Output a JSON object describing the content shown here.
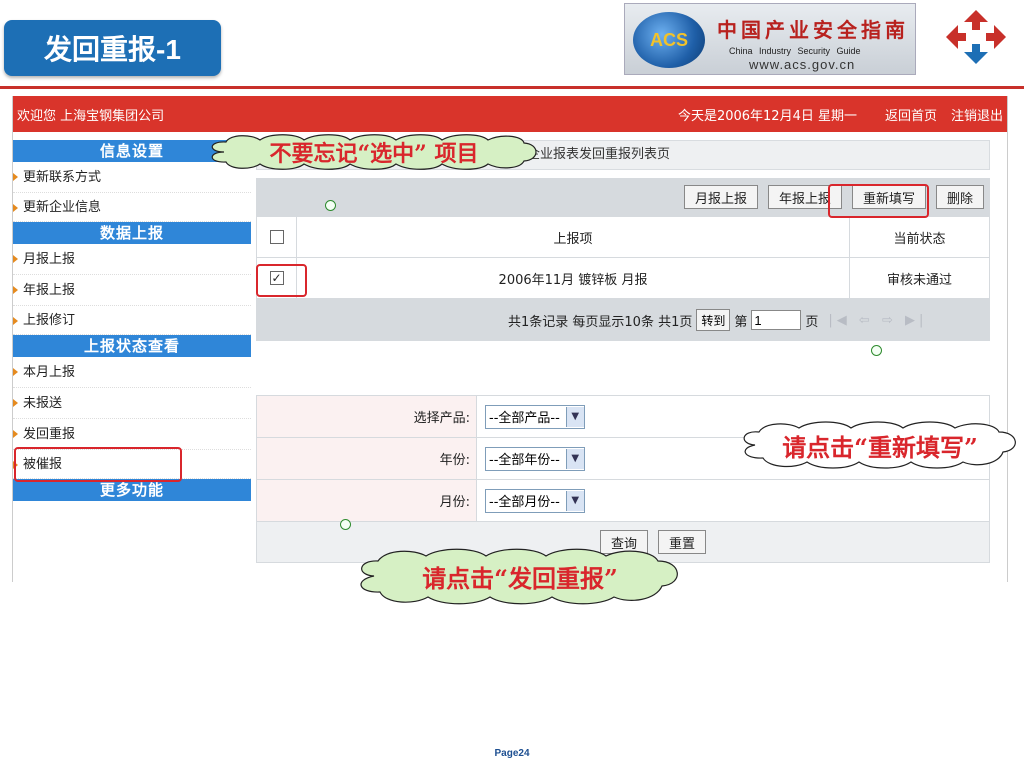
{
  "slide": {
    "title": "发回重报-1",
    "page": "Page24"
  },
  "brand": {
    "acronym": "ACS",
    "name_cn": "中国产业安全指南",
    "name_en": "China Industry Security Guide",
    "url": "www.acs.gov.cn"
  },
  "topbar": {
    "welcome": "欢迎您 上海宝钢集团公司",
    "date": "今天是2006年12月4日  星期一",
    "home_link": "返回首页",
    "logout_link": "注销退出"
  },
  "sidebar": {
    "section1": "信息设置",
    "item_contact": "更新联系方式",
    "item_company": "更新企业信息",
    "section2": "数据上报",
    "item_monthly": "月报上报",
    "item_yearly": "年报上报",
    "item_revise": "上报修订",
    "section3": "上报状态查看",
    "item_this_month": "本月上报",
    "item_unreported": "未报送",
    "item_returned": "发回重报",
    "item_urged": "被催报",
    "section4": "更多功能"
  },
  "main": {
    "breadcrumb": "企业报表发回重报列表页",
    "toolbar": {
      "monthly": "月报上报",
      "yearly": "年报上报",
      "refill": "重新填写",
      "delete": "删除"
    },
    "table": {
      "col_item": "上报项",
      "col_status": "当前状态",
      "rows": [
        {
          "item": "2006年11月  镀锌板  月报",
          "status": "审核未通过",
          "checked": true
        }
      ]
    },
    "pager": {
      "summary": "共1条记录   每页显示10条   共1页",
      "goto": "转到",
      "page_prefix": "第",
      "page_value": "1",
      "page_suffix": "页"
    },
    "form": {
      "product_label": "选择产品:",
      "product_value": "--全部产品--",
      "year_label": "年份:",
      "year_value": "--全部年份--",
      "month_label": "月份:",
      "month_value": "--全部月份--",
      "query": "查询",
      "reset": "重置"
    }
  },
  "callouts": {
    "select_reminder": "不要忘记“选中” 项目",
    "click_refill": "请点击“重新填写”",
    "click_returned": "请点击“发回重报”"
  },
  "colors": {
    "accent_red": "#d9342b",
    "sidebar_blue": "#2f86d8",
    "highlight": "#d9262c"
  }
}
